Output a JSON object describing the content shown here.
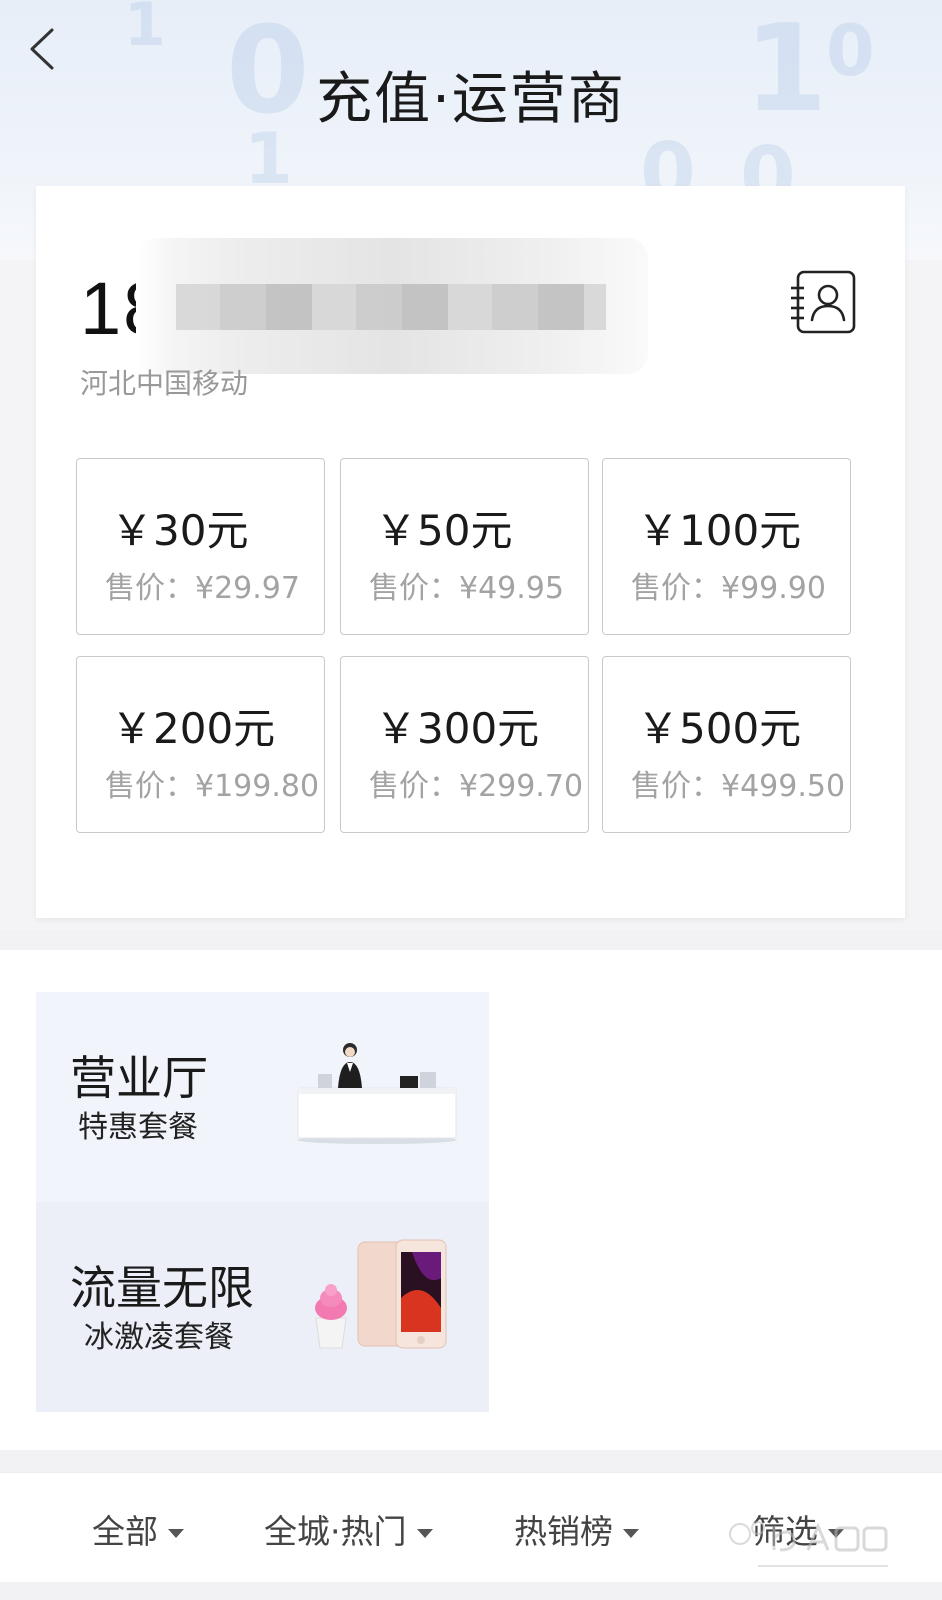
{
  "header": {
    "title": "充值·运营商",
    "back_icon": "chevron-left-icon"
  },
  "account": {
    "phone_number_visible": "18",
    "carrier": "河北中国移动",
    "contacts_icon": "contacts-book-icon"
  },
  "amounts": [
    {
      "face": "￥30元",
      "price": "售价：¥29.97"
    },
    {
      "face": "￥50元",
      "price": "售价：¥49.95"
    },
    {
      "face": "￥100元",
      "price": "售价：¥99.90"
    },
    {
      "face": "￥200元",
      "price": "售价：¥199.80"
    },
    {
      "face": "￥300元",
      "price": "售价：¥299.70"
    },
    {
      "face": "￥500元",
      "price": "售价：¥499.50"
    }
  ],
  "promos": [
    {
      "title": "营业厅",
      "subtitle": "特惠套餐",
      "image_icon": "service-desk-image"
    },
    {
      "title": "流量无限",
      "subtitle": "冰激凌套餐",
      "image_icon": "phone-icecream-image"
    }
  ],
  "filters": [
    {
      "label": "全部"
    },
    {
      "label": "全城·热门"
    },
    {
      "label": "热销榜"
    },
    {
      "label": "筛选"
    }
  ],
  "colors": {
    "header_bg": "#e7eef8",
    "tile_border": "#c9c9c9",
    "price_gray": "#a3a3a3",
    "promo_bg_1": "#f1f5fb",
    "promo_bg_2": "#eceff8"
  }
}
